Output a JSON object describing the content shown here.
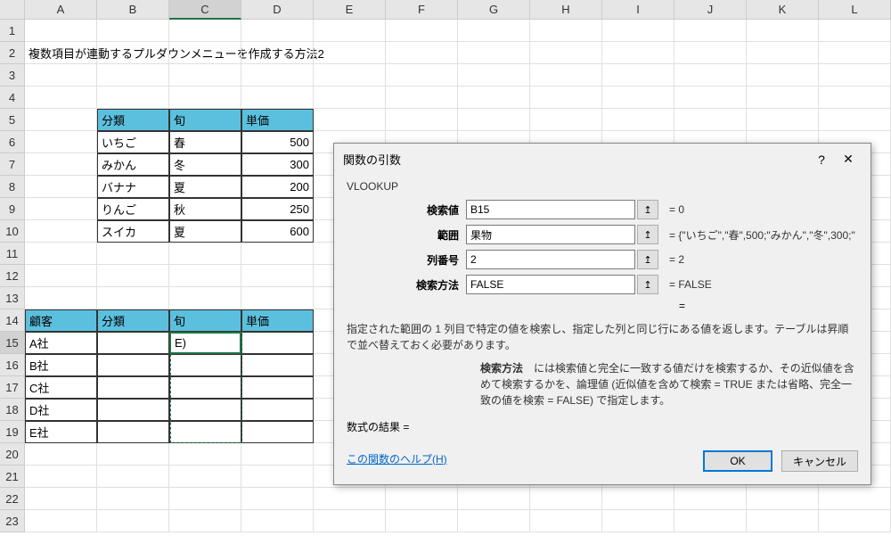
{
  "columns": [
    "A",
    "B",
    "C",
    "D",
    "E",
    "F",
    "G",
    "H",
    "I",
    "J",
    "K",
    "L"
  ],
  "rows": [
    1,
    2,
    3,
    4,
    5,
    6,
    7,
    8,
    9,
    10,
    11,
    12,
    13,
    14,
    15,
    16,
    17,
    18,
    19,
    20,
    21,
    22,
    23
  ],
  "title_cell": "複数項目が連動するプルダウンメニューを作成する方法2",
  "table1": {
    "headers": [
      "分類",
      "旬",
      "単価"
    ],
    "rows": [
      [
        "いちご",
        "春",
        "500"
      ],
      [
        "みかん",
        "冬",
        "300"
      ],
      [
        "バナナ",
        "夏",
        "200"
      ],
      [
        "りんご",
        "秋",
        "250"
      ],
      [
        "スイカ",
        "夏",
        "600"
      ]
    ]
  },
  "table2": {
    "headers": [
      "顧客",
      "分類",
      "旬",
      "単価"
    ],
    "rows": [
      [
        "A社",
        "",
        "E)",
        ""
      ],
      [
        "B社",
        "",
        "",
        ""
      ],
      [
        "C社",
        "",
        "",
        ""
      ],
      [
        "D社",
        "",
        "",
        ""
      ],
      [
        "E社",
        "",
        "",
        ""
      ]
    ]
  },
  "dialog": {
    "title": "関数の引数",
    "func": "VLOOKUP",
    "args": [
      {
        "label": "検索値",
        "value": "B15",
        "result": "= 0"
      },
      {
        "label": "範囲",
        "value": "果物",
        "result": "= {\"いちご\",\"春\",500;\"みかん\",\"冬\",300;\""
      },
      {
        "label": "列番号",
        "value": "2",
        "result": "= 2"
      },
      {
        "label": "検索方法",
        "value": "FALSE",
        "result": "= FALSE"
      }
    ],
    "eq": "=",
    "desc1": "指定された範囲の 1 列目で特定の値を検索し、指定した列と同じ行にある値を返します。テーブルは昇順で並べ替えておく必要があります。",
    "desc2_label": "検索方法",
    "desc2_text": "には検索値と完全に一致する値だけを検索するか、その近似値を含めて検索するかを、論理値 (近似値を含めて検索 = TRUE または省略、完全一致の値を検索 = FALSE) で指定します。",
    "result_label": "数式の結果 =",
    "help": "この関数のヘルプ(H)",
    "ok": "OK",
    "cancel": "キャンセル",
    "help_icon": "?",
    "close_icon": "✕"
  }
}
